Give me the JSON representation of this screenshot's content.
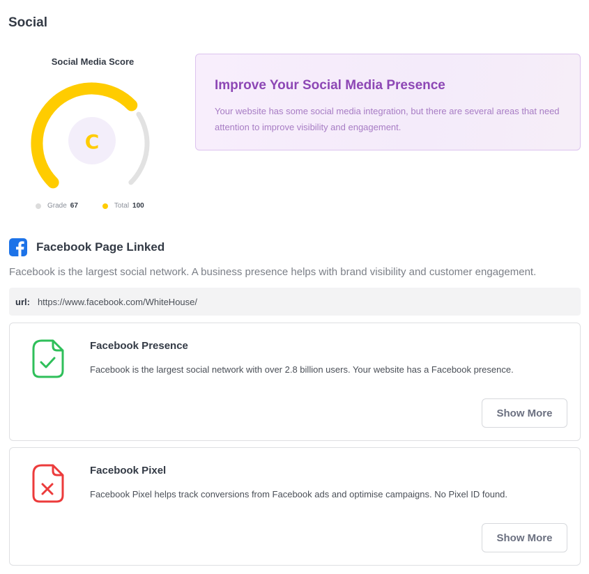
{
  "section": {
    "title": "Social"
  },
  "score": {
    "title": "Social Media Score",
    "grade_letter": "C",
    "legend": [
      {
        "label": "Grade",
        "value": "67",
        "color": "#dcdcdc"
      },
      {
        "label": "Total",
        "value": "100",
        "color": "#ffcc00"
      }
    ],
    "progress": 0.67,
    "colors": {
      "filled": "#ffcc00",
      "track": "#e2e2e2",
      "center": "#f3eefa"
    }
  },
  "improve": {
    "title": "Improve Your Social Media Presence",
    "text": "Your website has some social media integration, but there are several areas that need attention to improve visibility and engagement."
  },
  "facebook": {
    "icon": "facebook-icon",
    "heading": "Facebook Page Linked",
    "description": "Facebook is the largest social network. A business presence helps with brand visibility and customer engagement.",
    "url_label": "url:",
    "url_value": "https://www.facebook.com/WhiteHouse/"
  },
  "checks": [
    {
      "title": "Facebook Presence",
      "text": "Facebook is the largest social network with over 2.8 billion users. Your website has a Facebook presence.",
      "button": "Show More",
      "status": "pass",
      "icon": "file-check-icon",
      "color": "#2fbf5a"
    },
    {
      "title": "Facebook Pixel",
      "text": "Facebook Pixel helps track conversions from Facebook ads and optimise campaigns. No Pixel ID found.",
      "button": "Show More",
      "status": "fail",
      "icon": "file-x-icon",
      "color": "#ec3b3b"
    }
  ]
}
